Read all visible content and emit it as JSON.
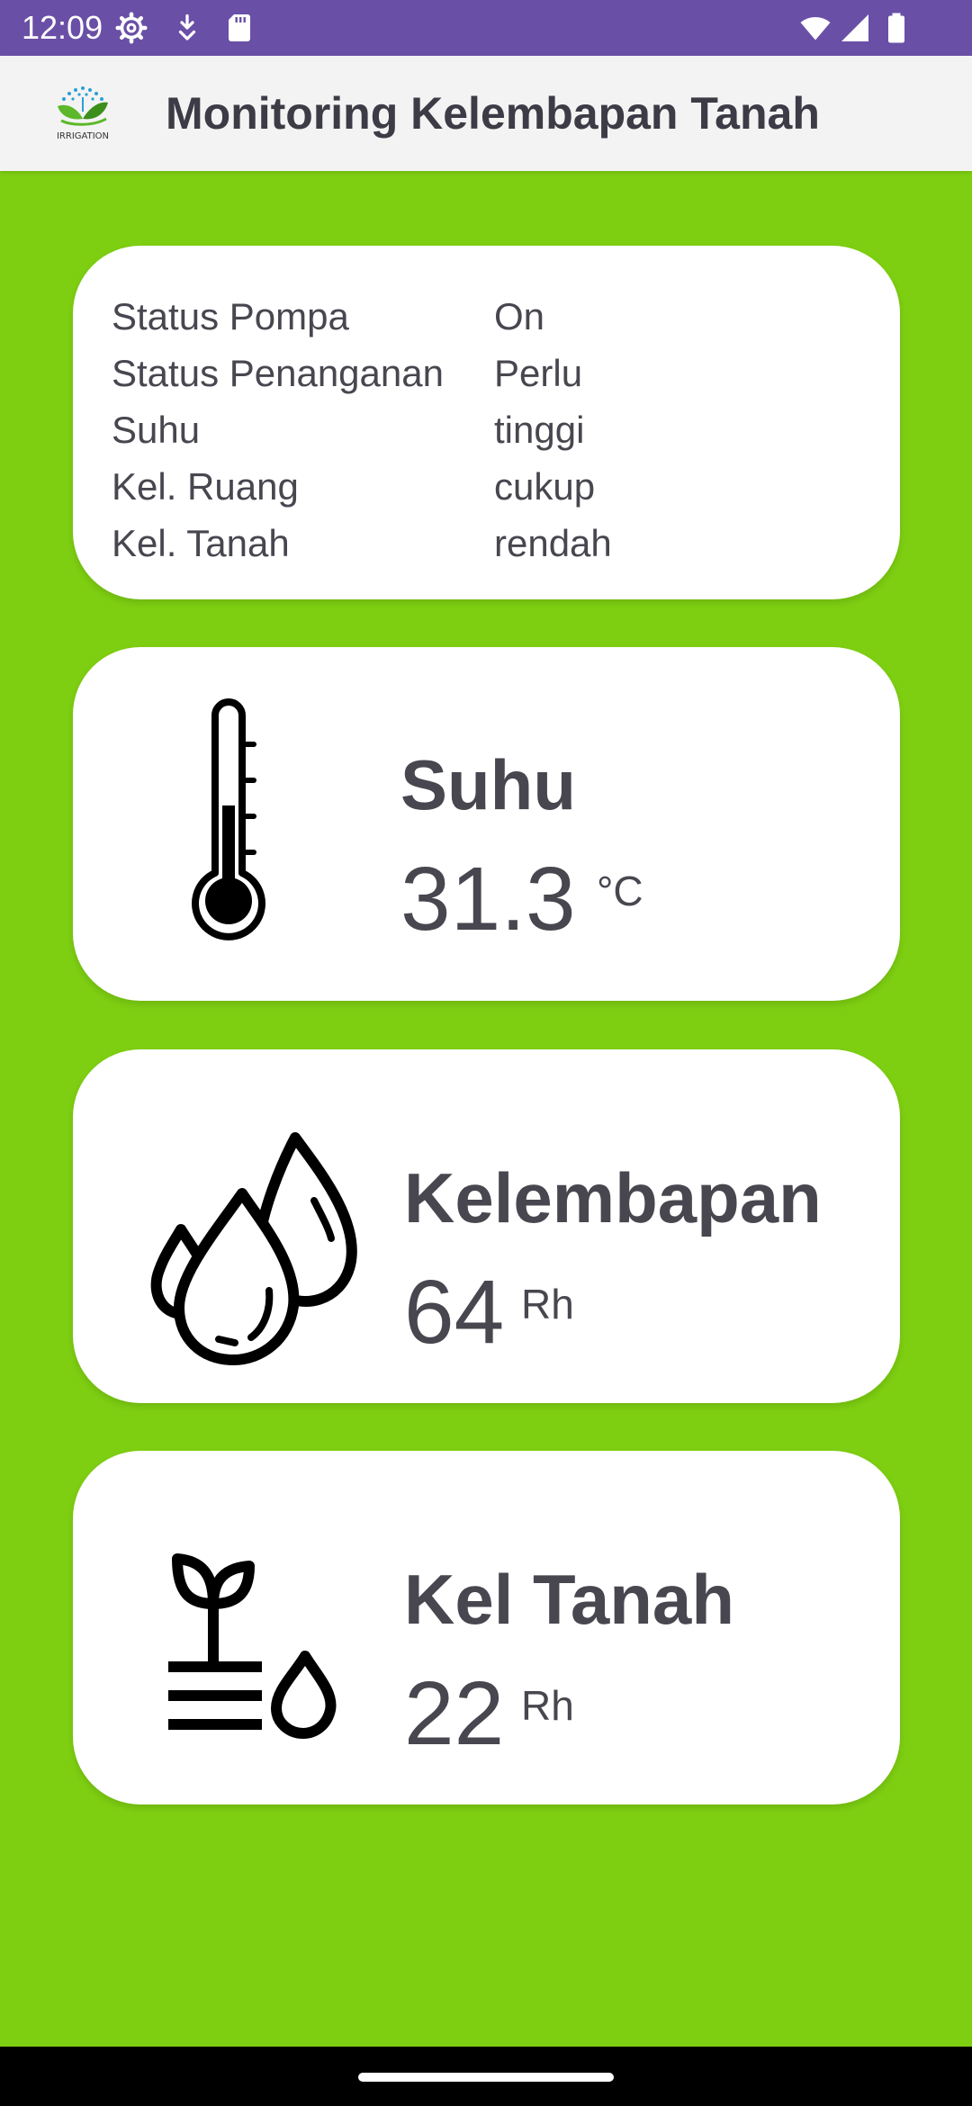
{
  "status_bar": {
    "time": "12:09",
    "icons": [
      "settings-icon",
      "download-icon",
      "sd-card-icon",
      "wifi-icon",
      "signal-icon",
      "battery-icon"
    ]
  },
  "app_bar": {
    "title": "Monitoring Kelembapan Tanah",
    "logo_text": "IRRIGATION",
    "logo_icon": "irrigation-logo-icon"
  },
  "status": {
    "rows": [
      {
        "label": "Status Pompa",
        "value": "On"
      },
      {
        "label": "Status Penanganan",
        "value": "Perlu"
      },
      {
        "label": "Suhu",
        "value": "tinggi"
      },
      {
        "label": "Kel. Ruang",
        "value": "cukup"
      },
      {
        "label": "Kel. Tanah",
        "value": "rendah"
      }
    ]
  },
  "sensors": {
    "suhu": {
      "title": "Suhu",
      "value": "31.3",
      "unit": "°C",
      "icon": "thermometer-icon"
    },
    "kelembapan": {
      "title": "Kelembapan",
      "value": "64",
      "unit": "Rh",
      "icon": "water-drops-icon"
    },
    "tanah": {
      "title": "Kel Tanah",
      "value": "22",
      "unit": "Rh",
      "icon": "soil-moisture-icon"
    }
  },
  "colors": {
    "status_bar": "#6a4fa6",
    "app_bar": "#f3f3f3",
    "background": "#7ecf12",
    "card": "#ffffff",
    "text": "#48464f"
  }
}
